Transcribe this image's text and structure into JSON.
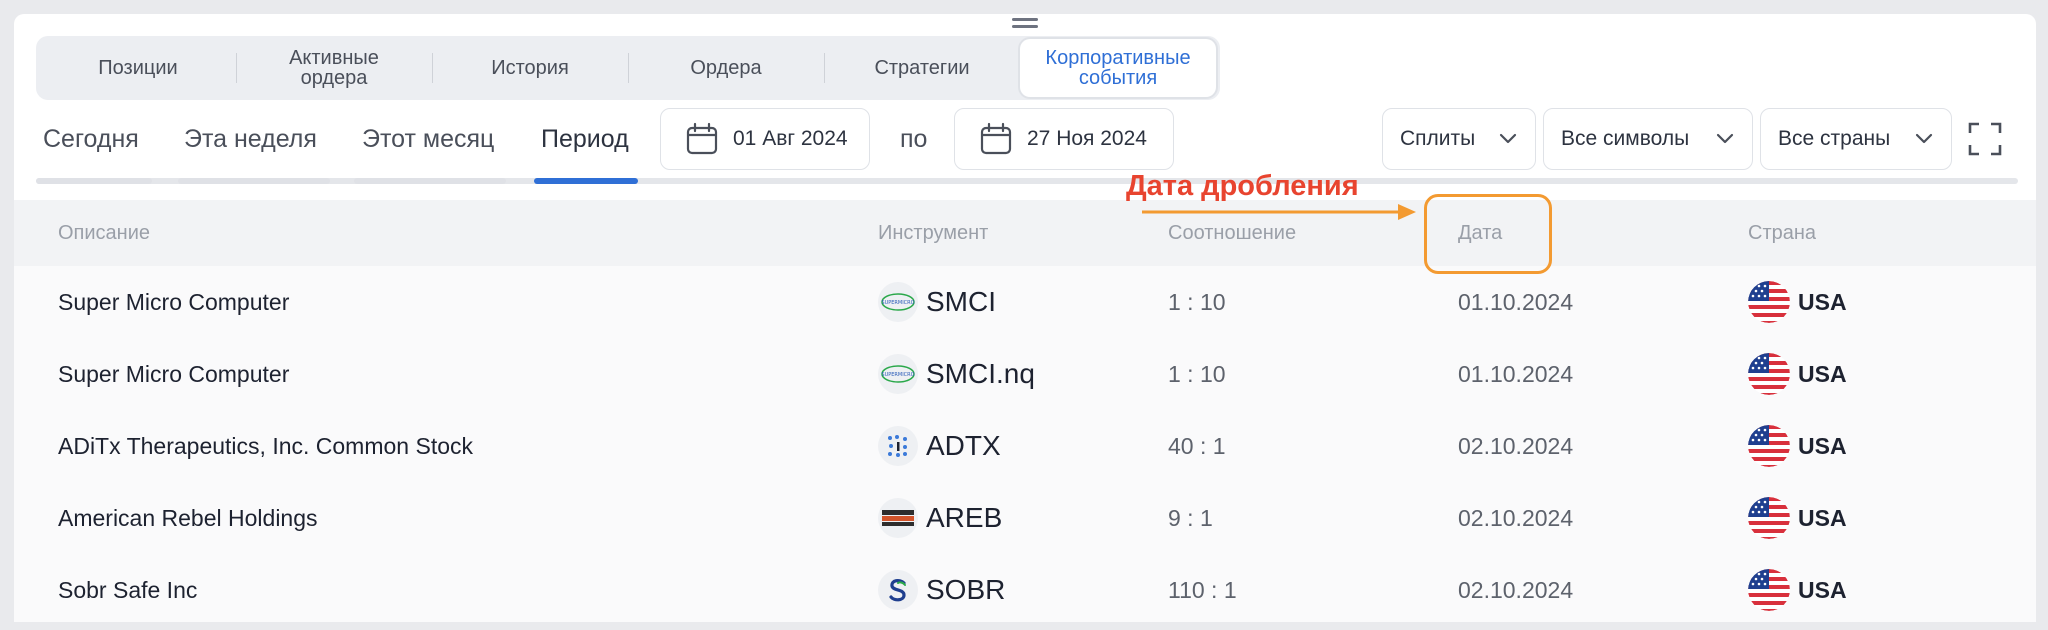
{
  "tabs": [
    {
      "label": "Позиции",
      "active": false
    },
    {
      "label": "Активные\nордера",
      "active": false
    },
    {
      "label": "История",
      "active": false
    },
    {
      "label": "Ордера",
      "active": false
    },
    {
      "label": "Стратегии",
      "active": false
    },
    {
      "label": "Корпоративные\nсобытия",
      "active": true
    }
  ],
  "periods": {
    "today": "Сегодня",
    "week": "Эта неделя",
    "month": "Этот месяц",
    "custom": "Период",
    "active": "custom"
  },
  "date_range": {
    "from": "01 Авг 2024",
    "separator": "по",
    "to": "27 Ноя 2024"
  },
  "filters": {
    "event_type": "Сплиты",
    "symbols": "Все символы",
    "countries": "Все страны"
  },
  "annotation": {
    "label": "Дата дробления",
    "color": "#e8442f",
    "box_color": "#f39a31"
  },
  "table": {
    "headers": {
      "description": "Описание",
      "instrument": "Инструмент",
      "ratio": "Соотношение",
      "date": "Дата",
      "country": "Страна"
    },
    "rows": [
      {
        "description": "Super Micro Computer",
        "symbol": "SMCI",
        "logo": "supermicro-logo",
        "ratio": "1 : 10",
        "date": "01.10.2024",
        "country": "USA"
      },
      {
        "description": "Super Micro Computer",
        "symbol": "SMCI.nq",
        "logo": "supermicro-logo",
        "ratio": "1 : 10",
        "date": "01.10.2024",
        "country": "USA"
      },
      {
        "description": "ADiTx Therapeutics, Inc. Common Stock",
        "symbol": "ADTX",
        "logo": "aditx-logo",
        "ratio": "40 : 1",
        "date": "02.10.2024",
        "country": "USA"
      },
      {
        "description": "American Rebel Holdings",
        "symbol": "AREB",
        "logo": "american-rebel-logo",
        "ratio": "9 : 1",
        "date": "02.10.2024",
        "country": "USA"
      },
      {
        "description": "Sobr Safe Inc",
        "symbol": "SOBR",
        "logo": "sobr-logo",
        "ratio": "110 : 1",
        "date": "02.10.2024",
        "country": "USA"
      }
    ]
  },
  "colors": {
    "accent": "#2f6fd6"
  }
}
